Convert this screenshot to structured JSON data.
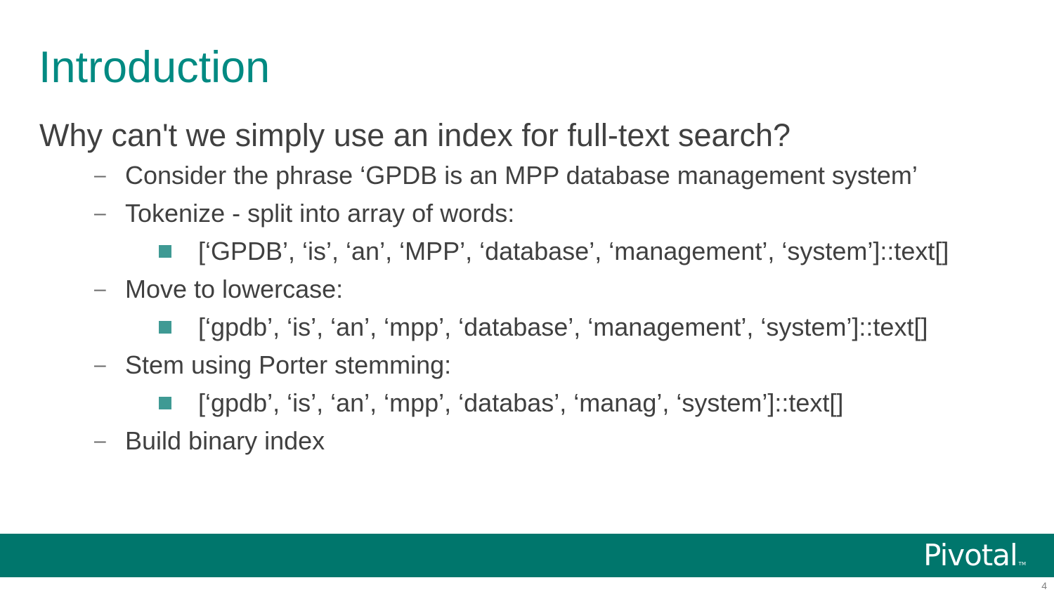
{
  "slide": {
    "title": "Introduction",
    "heading": "Why can't we simply use an index for full-text search?",
    "items": [
      {
        "marker": "–",
        "text": "Consider the phrase ‘GPDB is an MPP database management system’"
      },
      {
        "marker": "–",
        "text": "Tokenize - split into array of words:"
      },
      {
        "marker": "square",
        "text": "[‘GPDB’, ‘is’, ‘an’, ‘MPP’, ‘database’, ‘management’, ‘system’]::text[]"
      },
      {
        "marker": "–",
        "text": "Move to lowercase:"
      },
      {
        "marker": "square",
        "text": "[‘gpdb’, ‘is’, ‘an’, ‘mpp’, ‘database’, ‘management’, ‘system’]::text[]"
      },
      {
        "marker": "–",
        "text": "Stem using Porter stemming:"
      },
      {
        "marker": "square",
        "text": "[‘gpdb’, ‘is’, ‘an’, ‘mpp’, ‘databas’, ‘manag’, ‘system’]::text[]"
      },
      {
        "marker": "–",
        "text": "Build binary index"
      }
    ],
    "page_number": "4"
  },
  "footer": {
    "logo_text": "Pivotal",
    "logo_tm": "TM"
  },
  "colors": {
    "title": "#008a82",
    "footer_bar": "#00766c",
    "bullet_square": "#3f9a94",
    "body_text": "#404040"
  }
}
